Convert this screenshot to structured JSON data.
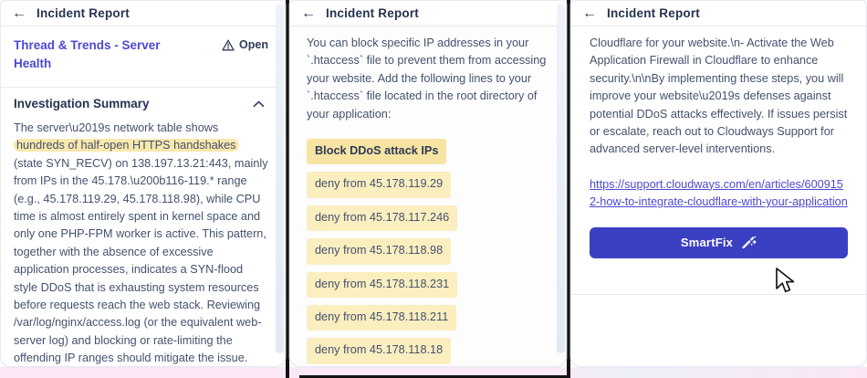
{
  "colors": {
    "accent_purple": "#4c49cf",
    "button_indigo": "#3b3fc2",
    "highlight_yellow": "#f9e8ac",
    "code_row_yellow": "#fbeebf",
    "code_title_yellow": "#f7e3a2",
    "header_text": "#26334f",
    "body_text": "#44516d",
    "pink_strip": "#fce9f7"
  },
  "icons": {
    "back": "←"
  },
  "p1": {
    "header_title": "Incident Report",
    "thread_title": "Thread & Trends - Server Health",
    "badge_label": "Open",
    "section_title": "Investigation Summary",
    "summary_part1": "The server\\u2019s network table shows ",
    "summary_highlight": "hundreds of half-open HTTPS handshakes",
    "summary_part2": " (state SYN_RECV) on 138.197.13.21:443, mainly from IPs in the 45.178.\\u200b116-119.* range (e.g., 45.178.119.29, 45.178.118.98), while CPU time is almost entirely spent in kernel space and only one PHP-FPM worker is active. This pattern, together with the absence of excessive application processes, indicates a SYN-flood style DDoS that is exhausting system resources before requests reach the web stack. Reviewing /var/log/nginx/access.log (or the equivalent web-server log) and blocking or rate-limiting the offending IP ranges should mitigate the issue."
  },
  "p2": {
    "header_title": "Incident Report",
    "intro": "You can block specific IP addresses in your `.htaccess` file to prevent them from accessing your website. Add the following lines to your `.htaccess` file located in the root directory of your application:",
    "code_title": "Block DDoS attack IPs",
    "code_lines": [
      "deny from 45.178.119.29",
      "deny from 45.178.117.246",
      "deny from 45.178.118.98",
      "deny from 45.178.118.231",
      "deny from 45.178.118.211",
      "deny from 45.178.118.18"
    ]
  },
  "p3": {
    "header_title": "Incident Report",
    "body": "Cloudflare for your website.\\n- Activate the Web Application Firewall in Cloudflare to enhance security.\\n\\nBy implementing these steps, you will improve your website\\u2019s defenses against potential DDoS attacks effectively. If issues persist or escalate, reach out to Cloudways Support for advanced server-level interventions.",
    "link": "https://support.cloudways.com/en/articles/6009152-how-to-integrate-cloudflare-with-your-application",
    "button_label": "SmartFix"
  }
}
